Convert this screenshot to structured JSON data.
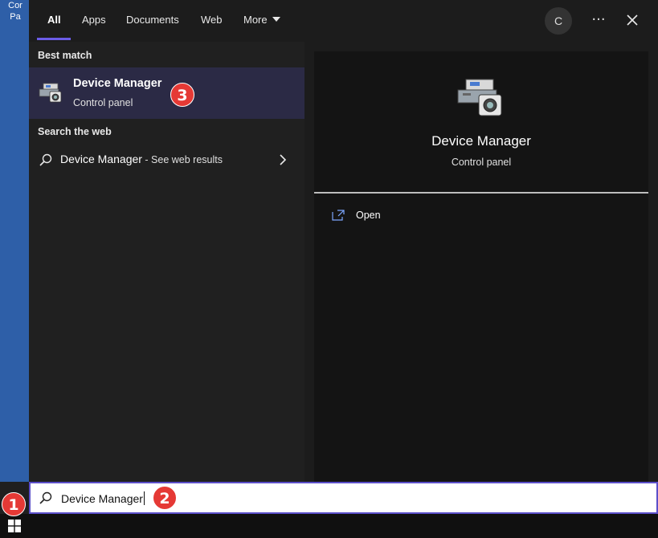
{
  "desktop": {
    "icon_label_line1": "Cor",
    "icon_label_line2": "Pa"
  },
  "tabs": {
    "all": "All",
    "apps": "Apps",
    "documents": "Documents",
    "web": "Web",
    "more": "More"
  },
  "header": {
    "avatar_initial": "C",
    "more_options": "···"
  },
  "left_pane": {
    "best_match_title": "Best match",
    "best_match": {
      "title": "Device Manager",
      "subtitle": "Control panel"
    },
    "search_web_title": "Search the web",
    "web_result": {
      "query": "Device Manager",
      "suffix": " - See web results"
    }
  },
  "right_pane": {
    "title": "Device Manager",
    "subtitle": "Control panel",
    "actions": [
      {
        "label": "Open",
        "icon": "open-icon"
      }
    ]
  },
  "search": {
    "value": "Device Manager"
  },
  "annotations": {
    "badge1": "1",
    "badge2": "2",
    "badge3": "3",
    "badge_color": "#e53935"
  },
  "colors": {
    "accent": "#6b5ce7",
    "selected_bg": "#2b2a45"
  }
}
